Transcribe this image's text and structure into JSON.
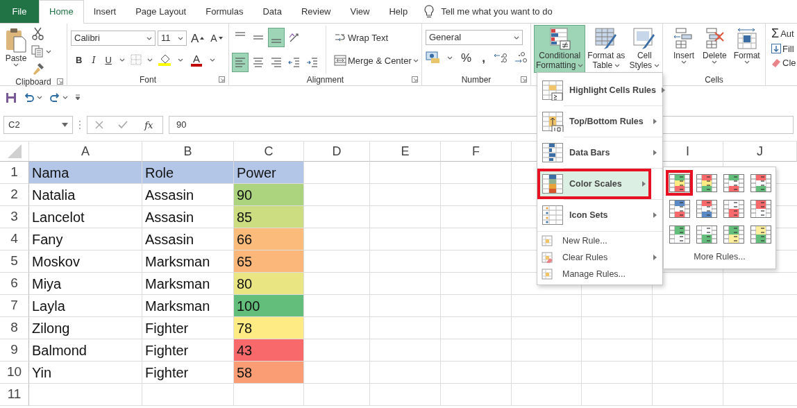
{
  "tabs": [
    {
      "label": "File",
      "kind": "file",
      "selected": false
    },
    {
      "label": "Home",
      "kind": "tab",
      "selected": true
    },
    {
      "label": "Insert",
      "kind": "tab",
      "selected": false
    },
    {
      "label": "Page Layout",
      "kind": "tab",
      "selected": false
    },
    {
      "label": "Formulas",
      "kind": "tab",
      "selected": false
    },
    {
      "label": "Data",
      "kind": "tab",
      "selected": false
    },
    {
      "label": "Review",
      "kind": "tab",
      "selected": false
    },
    {
      "label": "View",
      "kind": "tab",
      "selected": false
    },
    {
      "label": "Help",
      "kind": "tab",
      "selected": false
    }
  ],
  "tell_me": "Tell me what you want to do",
  "ribbon": {
    "groups": [
      {
        "kind": "clipboard",
        "label": "Clipboard",
        "paste": "Paste"
      },
      {
        "kind": "font",
        "label": "Font",
        "font_name": "Calibri",
        "font_size": "11",
        "grow": "A",
        "shrink": "A",
        "bold": "B",
        "italic": "I",
        "underline": "U",
        "font_color": "A"
      },
      {
        "kind": "alignment",
        "label": "Alignment",
        "wrap": "Wrap Text",
        "merge": "Merge & Center",
        "buttons": [
          {
            "kind": "top",
            "selected": false
          },
          {
            "kind": "middle",
            "selected": false
          },
          {
            "kind": "bottom",
            "selected": true
          },
          {
            "kind": "orientation",
            "selected": false
          },
          {
            "kind": "left",
            "selected": true
          },
          {
            "kind": "center",
            "selected": false
          },
          {
            "kind": "right",
            "selected": false
          },
          {
            "kind": "outdent",
            "selected": false
          },
          {
            "kind": "indent",
            "selected": false
          }
        ]
      },
      {
        "kind": "number",
        "label": "Number",
        "format": "General",
        "percent": "%",
        "comma": ","
      },
      {
        "kind": "styles",
        "buttons": [
          {
            "kind": "conditional",
            "lines": [
              "Conditional",
              "Formatting"
            ],
            "selected": true
          },
          {
            "kind": "table",
            "lines": [
              "Format as",
              "Table"
            ],
            "selected": false
          },
          {
            "kind": "cellstyles",
            "lines": [
              "Cell",
              "Styles"
            ],
            "selected": false
          }
        ]
      },
      {
        "kind": "cells",
        "label": "Cells",
        "buttons": [
          {
            "kind": "insert",
            "label": "Insert"
          },
          {
            "kind": "delete",
            "label": "Delete"
          },
          {
            "kind": "format",
            "label": "Format"
          }
        ]
      },
      {
        "kind": "editing",
        "items": [
          {
            "kind": "sum",
            "symbol": "Σ",
            "label": "Aut"
          },
          {
            "kind": "fill",
            "label": "Fill"
          },
          {
            "kind": "clear",
            "label": "Cle"
          }
        ]
      }
    ]
  },
  "name_box": "C2",
  "fx": "fx",
  "formula": "90",
  "columns": [
    "A",
    "B",
    "C",
    "D",
    "E",
    "F",
    null,
    null,
    "I",
    "J"
  ],
  "rows": [
    {
      "number": "1",
      "kind": "header",
      "cells": [
        {
          "text": "Nama"
        },
        {
          "text": "Role"
        },
        {
          "text": "Power"
        }
      ]
    },
    {
      "number": "2",
      "kind": "data",
      "cells": [
        {
          "text": "Natalia"
        },
        {
          "text": "Assasin"
        },
        {
          "text": "90",
          "color": "#acd37e"
        }
      ]
    },
    {
      "number": "3",
      "kind": "data",
      "cells": [
        {
          "text": "Lancelot"
        },
        {
          "text": "Assasin"
        },
        {
          "text": "85",
          "color": "#cbdc81"
        }
      ]
    },
    {
      "number": "4",
      "kind": "data",
      "cells": [
        {
          "text": "Fany"
        },
        {
          "text": "Assasin"
        },
        {
          "text": "66",
          "color": "#fbbc7b"
        }
      ]
    },
    {
      "number": "5",
      "kind": "data",
      "cells": [
        {
          "text": "Moskov"
        },
        {
          "text": "Marksman"
        },
        {
          "text": "65",
          "color": "#fbb67a"
        }
      ]
    },
    {
      "number": "6",
      "kind": "data",
      "cells": [
        {
          "text": "Miya"
        },
        {
          "text": "Marksman"
        },
        {
          "text": "80",
          "color": "#e9e583"
        }
      ]
    },
    {
      "number": "7",
      "kind": "data",
      "cells": [
        {
          "text": "Layla"
        },
        {
          "text": "Marksman"
        },
        {
          "text": "100",
          "color": "#63be7b"
        }
      ]
    },
    {
      "number": "8",
      "kind": "data",
      "cells": [
        {
          "text": "Zilong"
        },
        {
          "text": "Fighter"
        },
        {
          "text": "78",
          "color": "#ffeb84"
        }
      ]
    },
    {
      "number": "9",
      "kind": "data",
      "cells": [
        {
          "text": "Balmond"
        },
        {
          "text": "Fighter"
        },
        {
          "text": "43",
          "color": "#f8696b"
        }
      ]
    },
    {
      "number": "10",
      "kind": "data",
      "cells": [
        {
          "text": "Yin"
        },
        {
          "text": "Fighter"
        },
        {
          "text": "58",
          "color": "#fa9d75"
        }
      ]
    },
    {
      "number": "11",
      "kind": "data"
    }
  ],
  "menu": {
    "items": [
      {
        "label": "Highlight Cells Rules",
        "kind": "large",
        "submenu": true,
        "selected": false
      },
      {
        "label": "Top/Bottom Rules",
        "kind": "large",
        "submenu": true,
        "selected": false
      },
      {
        "label": "Data Bars",
        "kind": "large",
        "submenu": true,
        "selected": false
      },
      {
        "label": "Color Scales",
        "kind": "large",
        "submenu": true,
        "selected": true
      },
      {
        "label": "Icon Sets",
        "kind": "large",
        "submenu": true,
        "selected": false
      },
      {
        "label": "New Rule...",
        "kind": "small",
        "submenu": false,
        "selected": false
      },
      {
        "label": "Clear Rules",
        "kind": "small",
        "submenu": true,
        "selected": false
      },
      {
        "label": "Manage Rules...",
        "kind": "small",
        "submenu": false,
        "selected": false
      }
    ]
  },
  "color_scales": {
    "swatches": [
      {
        "bands": [
          {
            "color": "#63be7b"
          },
          {
            "color": "#ffeb84"
          },
          {
            "color": "#f8696b"
          }
        ],
        "selected": true
      },
      {
        "bands": [
          {
            "color": "#f8696b"
          },
          {
            "color": "#ffeb84"
          },
          {
            "color": "#63be7b"
          }
        ],
        "selected": false
      },
      {
        "bands": [
          {
            "color": "#63be7b"
          },
          {
            "color": "#fcfcff"
          },
          {
            "color": "#f8696b"
          }
        ],
        "selected": false
      },
      {
        "bands": [
          {
            "color": "#f8696b"
          },
          {
            "color": "#fcfcff"
          },
          {
            "color": "#63be7b"
          }
        ],
        "selected": false
      },
      {
        "bands": [
          {
            "color": "#5a8ac6"
          },
          {
            "color": "#fcfcff"
          },
          {
            "color": "#f8696b"
          }
        ],
        "selected": false
      },
      {
        "bands": [
          {
            "color": "#f8696b"
          },
          {
            "color": "#fcfcff"
          },
          {
            "color": "#5a8ac6"
          }
        ],
        "selected": false
      },
      {
        "bands": [
          {
            "color": "#fcfcff"
          },
          {
            "color": "#f8696b"
          }
        ],
        "selected": false
      },
      {
        "bands": [
          {
            "color": "#f8696b"
          },
          {
            "color": "#fcfcff"
          }
        ],
        "selected": false
      },
      {
        "bands": [
          {
            "color": "#63be7b"
          },
          {
            "color": "#fcfcff"
          }
        ],
        "selected": false
      },
      {
        "bands": [
          {
            "color": "#fcfcff"
          },
          {
            "color": "#63be7b"
          }
        ],
        "selected": false
      },
      {
        "bands": [
          {
            "color": "#63be7b"
          },
          {
            "color": "#ffef9c"
          }
        ],
        "selected": false
      },
      {
        "bands": [
          {
            "color": "#ffef9c"
          },
          {
            "color": "#63be7b"
          }
        ],
        "selected": false
      }
    ],
    "more": "More Rules..."
  }
}
